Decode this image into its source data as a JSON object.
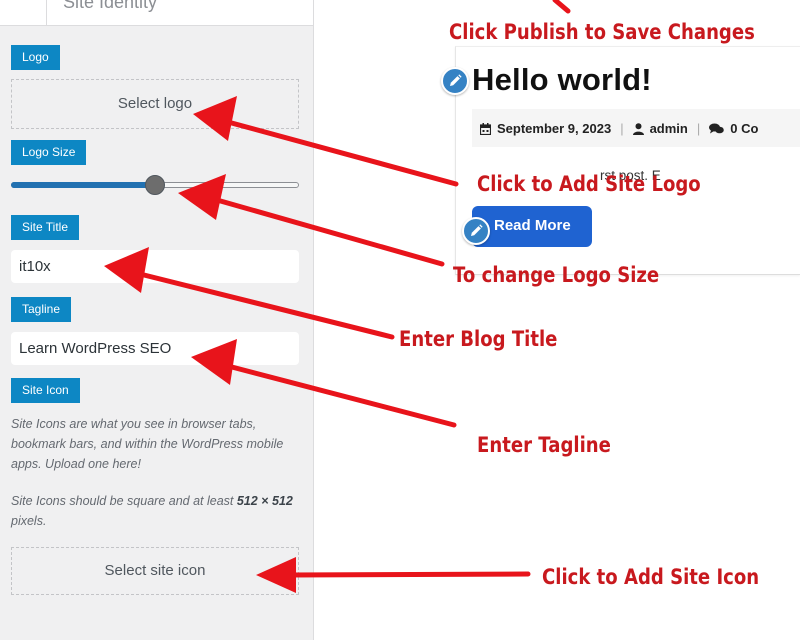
{
  "customizer": {
    "section_title": "Site Identity",
    "logo": {
      "label": "Logo",
      "button": "Select logo"
    },
    "logo_size": {
      "label": "Logo Size",
      "value_fraction": 0.5
    },
    "site_title": {
      "label": "Site Title",
      "value": "it10x"
    },
    "tagline": {
      "label": "Tagline",
      "value": "Learn WordPress SEO"
    },
    "site_icon": {
      "label": "Site Icon",
      "description_1": "Site Icons are what you see in browser tabs, bookmark bars, and within the WordPress mobile apps. Upload one here!",
      "description_2_pre": "Site Icons should be square and at least ",
      "description_2_size": "512 × 512",
      "description_2_post": " pixels.",
      "button": "Select site icon"
    }
  },
  "preview": {
    "post_title": "Hello world!",
    "date": "September 9, 2023",
    "author": "admin",
    "comments": "0 Co",
    "excerpt": "rst post. E",
    "read_more": "Read More"
  },
  "annotations": {
    "publish": "Click Publish to Save Changes",
    "add_logo": "Click to Add Site Logo",
    "logo_size": "To change Logo Size",
    "blog_title": "Enter Blog Title",
    "tagline": "Enter Tagline",
    "add_icon": "Click to Add Site Icon"
  },
  "colors": {
    "label_bg": "#0d87c4",
    "annotation_red": "#c8191e",
    "read_more_bg": "#1f63d1",
    "slider_fill": "#2271b1"
  },
  "icons": [
    "calendar-icon",
    "user-icon",
    "comments-icon",
    "pencil-icon"
  ]
}
